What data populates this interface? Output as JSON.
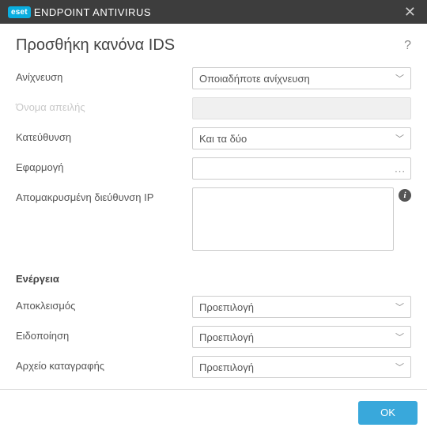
{
  "window": {
    "brand": "eset",
    "title": "ENDPOINT ANTIVIRUS"
  },
  "page": {
    "title": "Προσθήκη κανόνα IDS"
  },
  "fields": {
    "detection": {
      "label": "Ανίχνευση",
      "value": "Οποιαδήποτε ανίχνευση"
    },
    "threat_name": {
      "label": "Όνομα απειλής",
      "value": ""
    },
    "direction": {
      "label": "Κατεύθυνση",
      "value": "Και τα δύο"
    },
    "application": {
      "label": "Εφαρμογή",
      "value": ""
    },
    "remote_ip": {
      "label": "Απομακρυσμένη διεύθυνση IP",
      "value": ""
    }
  },
  "action_section": {
    "title": "Ενέργεια",
    "block": {
      "label": "Αποκλεισμός",
      "value": "Προεπιλογή"
    },
    "notify": {
      "label": "Ειδοποίηση",
      "value": "Προεπιλογή"
    },
    "log": {
      "label": "Αρχείο καταγραφής",
      "value": "Προεπιλογή"
    }
  },
  "buttons": {
    "ok": "OK"
  }
}
